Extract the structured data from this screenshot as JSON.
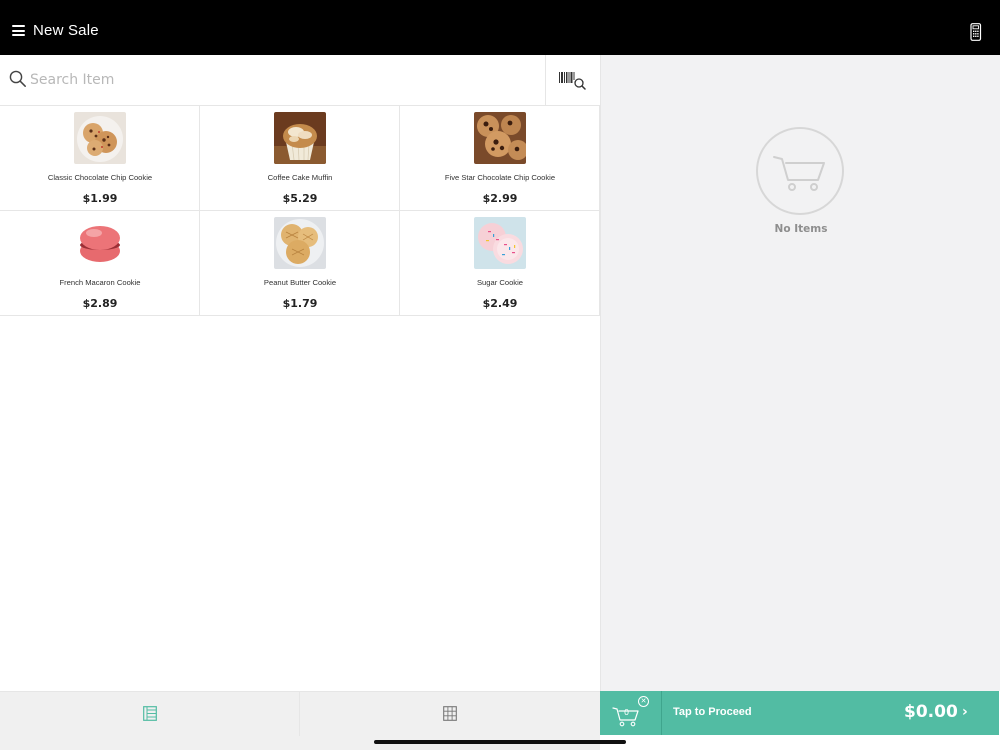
{
  "header": {
    "title": "New Sale",
    "menu_icon": "hamburger-icon",
    "right_icon": "calculator-icon"
  },
  "search": {
    "placeholder": "Search Item",
    "icon": "search-icon",
    "barcode_icon": "barcode-scan-icon"
  },
  "items": [
    {
      "name": "Classic Chocolate Chip Cookie",
      "price": "$1.99"
    },
    {
      "name": "Coffee Cake Muffin",
      "price": "$5.29"
    },
    {
      "name": "Five Star Chocolate Chip Cookie",
      "price": "$2.99"
    },
    {
      "name": "French Macaron Cookie",
      "price": "$2.89"
    },
    {
      "name": "Peanut Butter Cookie",
      "price": "$1.79"
    },
    {
      "name": "Sugar Cookie",
      "price": "$2.49"
    }
  ],
  "cart": {
    "empty_label": "No Items",
    "count": "0",
    "proceed_label": "Tap to Proceed",
    "total": "$0.00",
    "chevron": "›",
    "clear_icon": "✕"
  },
  "colors": {
    "accent": "#52bca3",
    "header_bg": "#000000",
    "panel_bg": "#f2f2f3"
  }
}
